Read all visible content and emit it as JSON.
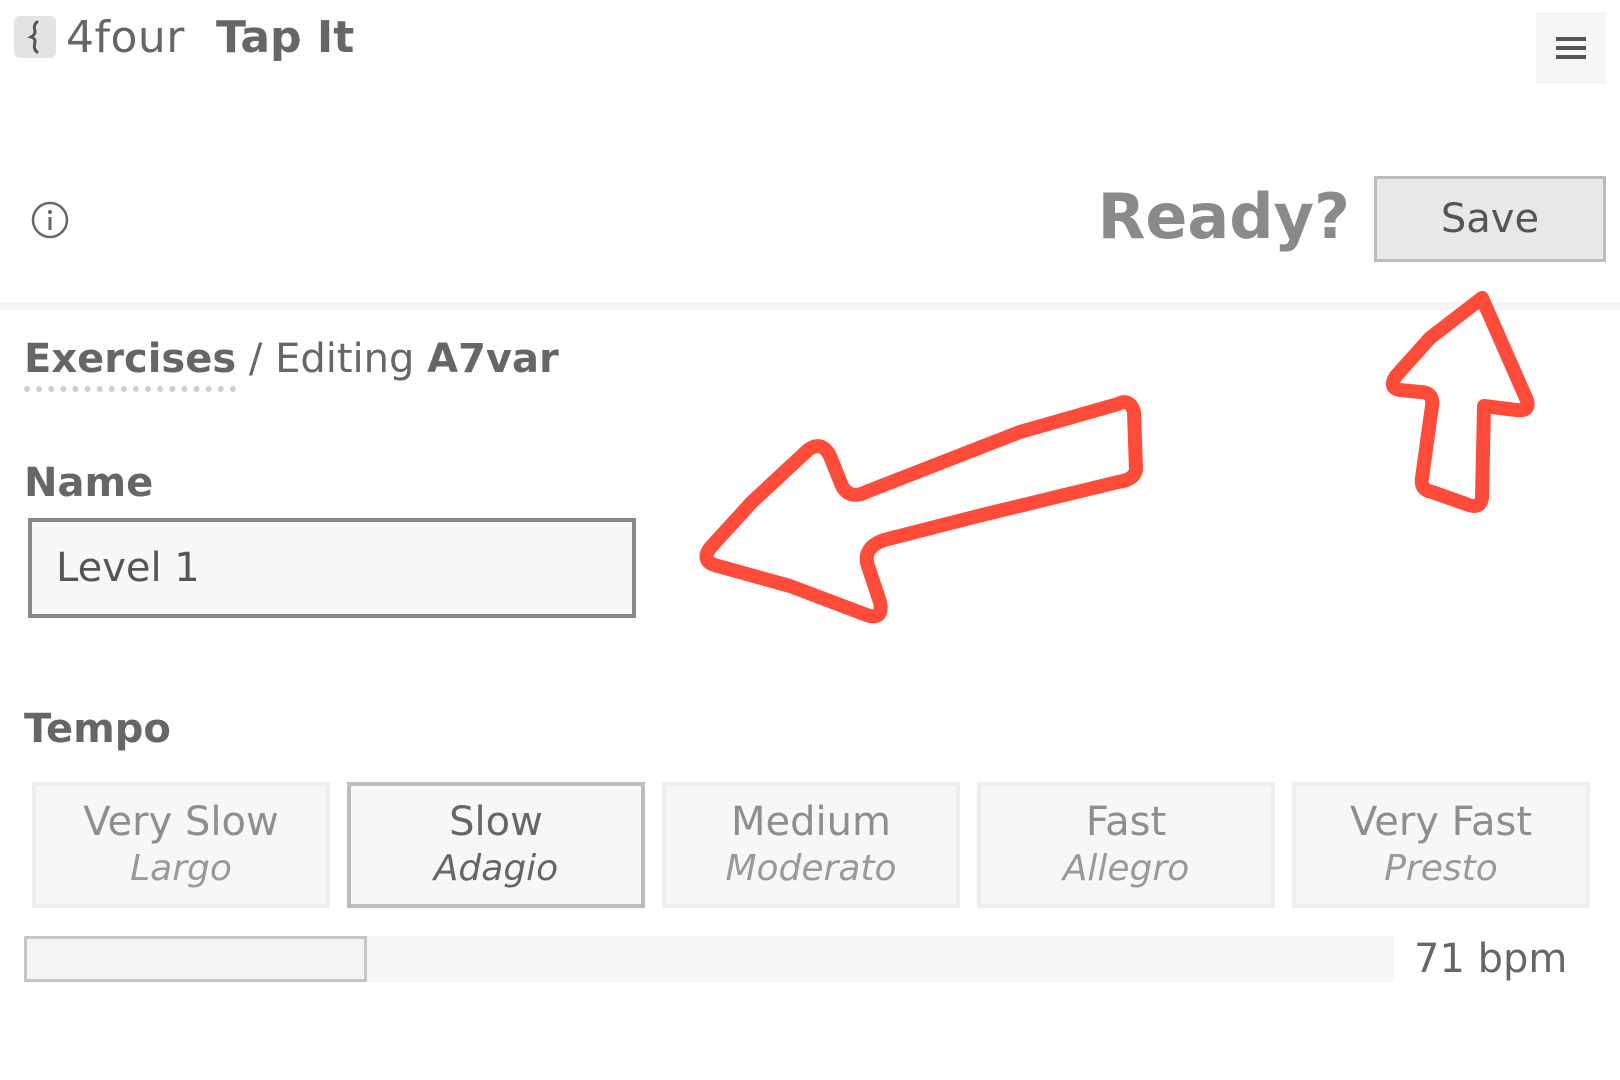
{
  "header": {
    "app_name": "4four",
    "page_title": "Tap It",
    "logo_icon": "metronome-logo-icon",
    "menu_icon": "hamburger-menu-icon"
  },
  "toolbar": {
    "info_icon": "info-icon",
    "ready_text": "Ready?",
    "save_label": "Save"
  },
  "breadcrumb": {
    "parent": "Exercises",
    "separator": "/ Editing",
    "current": "A7var"
  },
  "form": {
    "name_label": "Name",
    "name_value": "Level 1",
    "tempo_label": "Tempo",
    "tempo_options": [
      {
        "label": "Very Slow",
        "italian": "Largo"
      },
      {
        "label": "Slow",
        "italian": "Adagio"
      },
      {
        "label": "Medium",
        "italian": "Moderato"
      },
      {
        "label": "Fast",
        "italian": "Allegro"
      },
      {
        "label": "Very Fast",
        "italian": "Presto"
      }
    ],
    "selected_tempo": "Slow",
    "tempo_slider_fraction": 0.25,
    "bpm_text": "71 bpm"
  },
  "annotations": {
    "color": "#ff4b3a",
    "arrows": [
      "arrow-to-name-field",
      "arrow-to-save-button"
    ]
  }
}
